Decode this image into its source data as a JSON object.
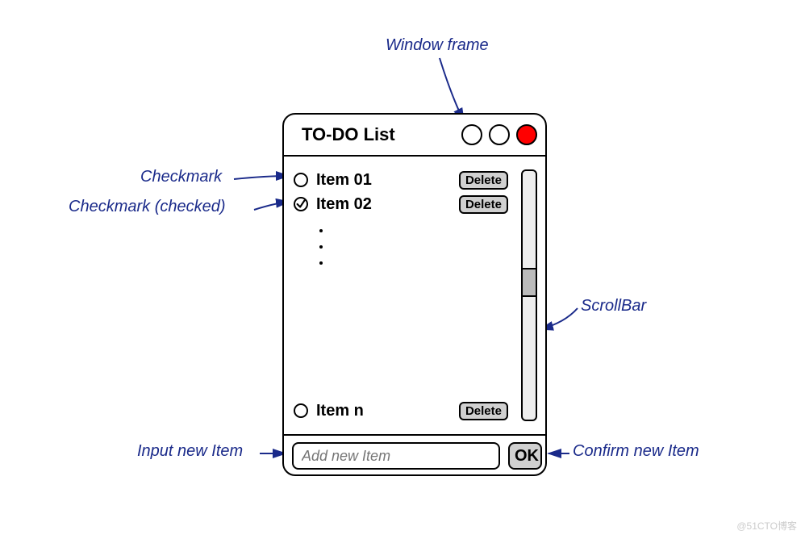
{
  "window": {
    "title": "TO-DO List",
    "buttons": {
      "close_color": "#ff0000"
    }
  },
  "items": [
    {
      "label": "Item 01",
      "checked": false,
      "delete_label": "Delete"
    },
    {
      "label": "Item 02",
      "checked": true,
      "delete_label": "Delete"
    },
    {
      "label": "Item n",
      "checked": false,
      "delete_label": "Delete"
    }
  ],
  "input": {
    "placeholder": "Add new Item",
    "confirm_label": "OK"
  },
  "annotations": {
    "window_frame": "Window frame",
    "checkmark": "Checkmark",
    "checkmark_checked": "Checkmark (checked)",
    "scrollbar": "ScrollBar",
    "input_new_item": "Input new Item",
    "confirm_new_item": "Confirm new Item"
  },
  "watermark": "@51CTO博客"
}
